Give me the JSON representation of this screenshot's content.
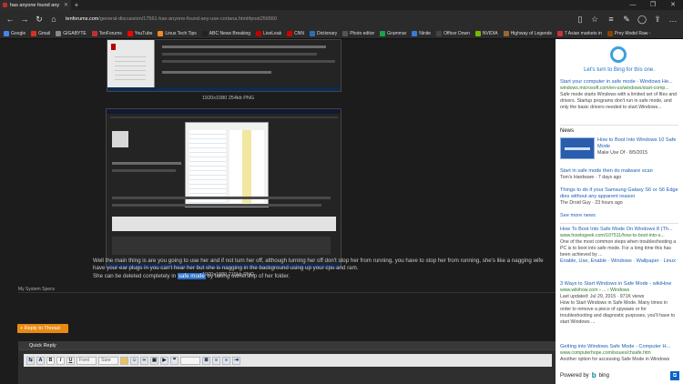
{
  "browser": {
    "tab_title": "has anyone found any u",
    "address_host": "tenforums.com",
    "address_path": "/general-discussion/17561-has-anyone-found-any-use-cortana.html#post256550",
    "favorites": [
      {
        "label": "Google",
        "color": "#4285f4"
      },
      {
        "label": "Gmail",
        "color": "#d93025"
      },
      {
        "label": "GIGABYTE",
        "color": "#888888"
      },
      {
        "label": "TenForums",
        "color": "#c03030"
      },
      {
        "label": "YouTube",
        "color": "#ff0000"
      },
      {
        "label": "Linus Tech Tips",
        "color": "#f08a24"
      },
      {
        "label": "ABC News  Breaking",
        "color": "#222222"
      },
      {
        "label": "LiveLeak",
        "color": "#c00000"
      },
      {
        "label": "CNN",
        "color": "#cc0000"
      },
      {
        "label": "Dictionary",
        "color": "#2a6fb5"
      },
      {
        "label": "Photo editor",
        "color": "#555555"
      },
      {
        "label": "Grammar",
        "color": "#16a34a"
      },
      {
        "label": "Ninite",
        "color": "#3a7ad6"
      },
      {
        "label": "Officer Down",
        "color": "#444444"
      },
      {
        "label": "NVIDIA",
        "color": "#76b900"
      },
      {
        "label": "Highway of Legends",
        "color": "#996633"
      },
      {
        "label": "7 Asian markets in",
        "color": "#cc3333"
      },
      {
        "label": "Prey Model Raw -",
        "color": "#884400"
      }
    ]
  },
  "post": {
    "caption_1": "1920x1080  254kb  PNG",
    "caption_2": "1920x1080  215kb  PNG",
    "line_1": "Well the main thing is are you going to use her and if not turn her off, although turning her off don't stop her from running, you have to stop her from running, she's like a nagging wife",
    "line_2": "have your ear plugs in you can't hear her but she is nagging in the background using up your cpu and ram.",
    "line_3_pre": "She can be deleted completely in ",
    "line_3_hl": "safe mode",
    "line_3_post": " by taking ownership of her folder.",
    "specs_label": "My System Specs",
    "reply_button": "+ Reply to Thread",
    "quick_reply": "Quick Reply"
  },
  "editor": {
    "font_select": "Font",
    "size_select": "Size",
    "bold": "B",
    "italic": "I",
    "underline": "U"
  },
  "cortana": {
    "title": "Let's turn to Bing for this one.",
    "results": [
      {
        "title": "Start your computer in safe mode - Windows He...",
        "url": "windows.microsoft.com/en-us/windows/start-comp...",
        "snippet": "Safe mode starts Windows with a limited set of files and drivers. Startup programs don't run in safe mode, and only the basic drivers needed to start Windows..."
      }
    ],
    "news_header": "News",
    "news": [
      {
        "title": "How to Boot Into Windows 10 Safe Mode",
        "meta": "Make Use Of · 8/5/2015"
      },
      {
        "title": "Start in safe mode then do malware scan",
        "meta": "Tom's Hardware · 7 days ago"
      },
      {
        "title": "Things to do if your Samsung Galaxy S6 or S6 Edge dies without any apparent reason",
        "meta": "The Droid Guy · 23 hours ago"
      }
    ],
    "see_more": "See more news",
    "results2": [
      {
        "title": "How To Boot Into Safe Mode On Windows 8 (Th...",
        "url": "www.howtogeek.com/107511/how-to-boot-into-s...",
        "snippet": "One of the most common steps when troubleshooting a PC is to boot into safe mode. For a long time this has been achieved by ...",
        "links": "Enable, Use, Enable · Windows · Wallpaper · Linux"
      },
      {
        "title": "3 Ways to Start Windows in Safe Mode - wikiHow",
        "url": "www.wikihow.com › ... › Windows",
        "meta": "Last updated: Jul 29, 2015 · 971K views",
        "snippet": "How to Start Windows in Safe Mode. Many times in order to remove a piece of spyware or for troubleshooting and diagnostic purposes, you'll have to start Windows ..."
      },
      {
        "title": "Getting into Windows Safe Mode - Computer H...",
        "url": "www.computerhope.com/issues/chsafe.htm",
        "snippet": "Another option for accessing Safe Mode in Windows"
      }
    ],
    "powered_by": "Powered by",
    "bing": "bing"
  }
}
